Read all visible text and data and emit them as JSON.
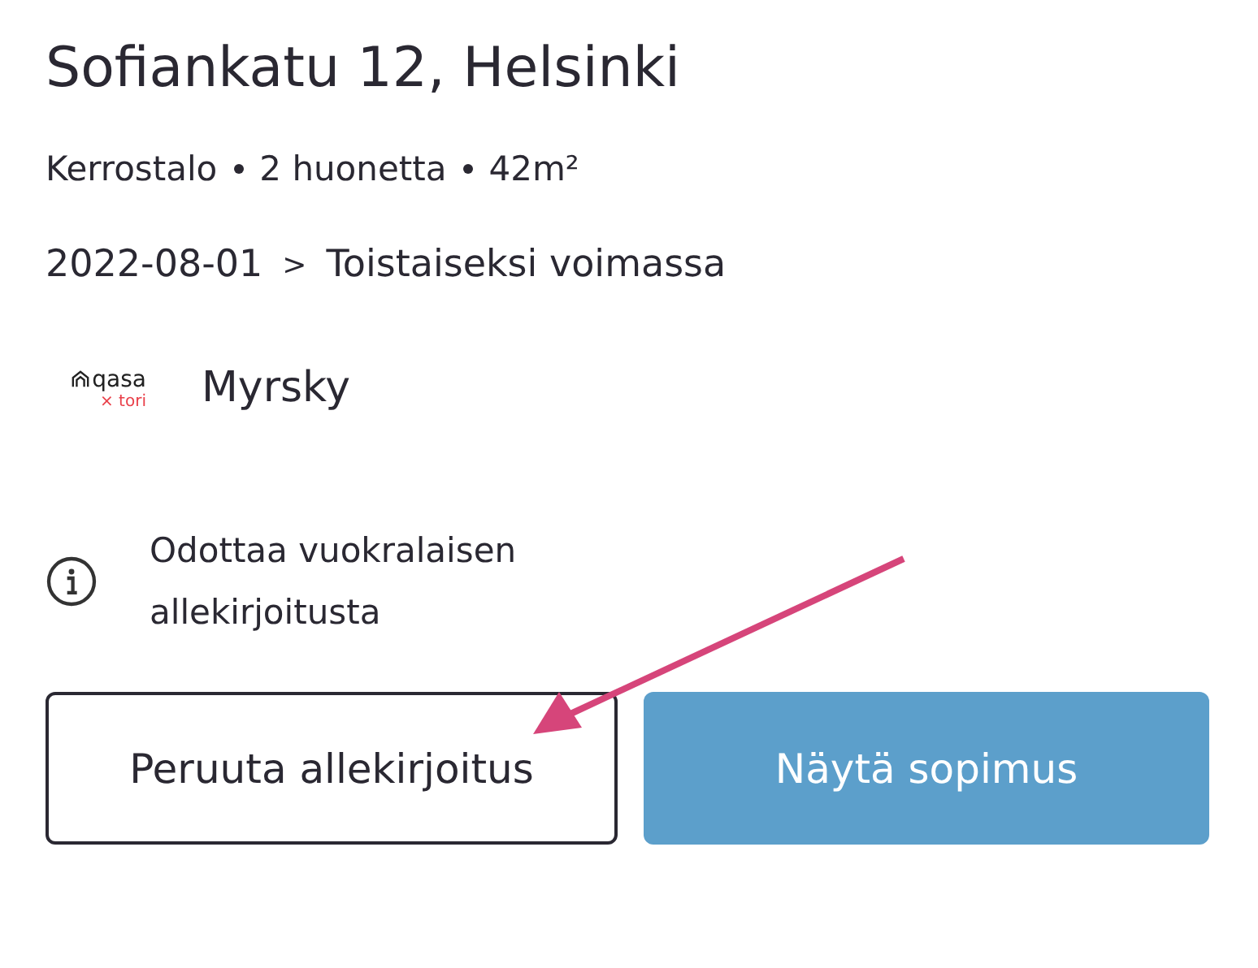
{
  "title": "Sofiankatu 12, Helsinki",
  "details": [
    "Kerrostalo",
    "2 huonetta",
    "42m²"
  ],
  "period": {
    "start": "2022-08-01",
    "separator": ">",
    "end": "Toistaiseksi voimassa"
  },
  "landlord": {
    "logo_name": "qasa",
    "logo_partner": "× tori",
    "name": "Myrsky"
  },
  "status": "Odottaa vuokralaisen allekirjoitusta",
  "buttons": [
    {
      "label": "Peruuta allekirjoitus",
      "kind": "outline"
    },
    {
      "label": "Näytä sopimus",
      "kind": "primary"
    }
  ]
}
